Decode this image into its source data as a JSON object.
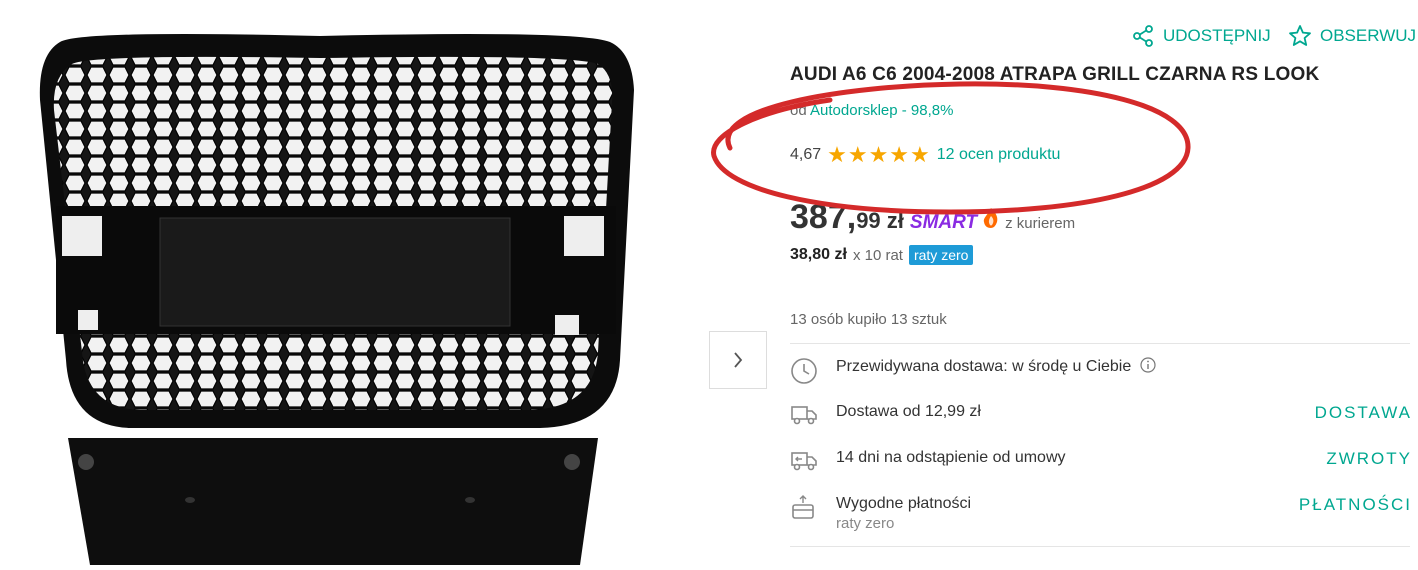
{
  "header": {
    "share_label": "UDOSTĘPNIJ",
    "observe_label": "OBSERWUJ"
  },
  "product": {
    "title": "AUDI A6 C6 2004-2008 ATRAPA GRILL CZARNA RS LOOK",
    "seller_prefix": "od",
    "seller_name": "Autodorsklep - 98,8%",
    "rating_value": "4,67",
    "rating_stars": 5,
    "rating_count": "12 ocen produktu",
    "price_main": "387,",
    "price_decimal": "99 zł",
    "smart_label": "SMART",
    "smart_sub": "z kurierem",
    "installment_amount": "38,80 zł",
    "installment_text": "x 10 rat",
    "installment_badge": "raty zero",
    "sold_info": "13 osób kupiło 13 sztuk"
  },
  "info_rows": [
    {
      "icon": "clock-icon",
      "text": "Przewidywana dostawa: w środę u Ciebie",
      "link": ""
    },
    {
      "icon": "truck-icon",
      "text": "Dostawa od 12,99 zł",
      "link": "DOSTAWA"
    },
    {
      "icon": "return-truck-icon",
      "text": "14 dni na odstąpienie od umowy",
      "link": "ZWROTY"
    },
    {
      "icon": "payment-icon",
      "text": "Wygodne płatności",
      "sub": "raty zero",
      "link": "PŁATNOŚCI"
    }
  ],
  "colors": {
    "accent": "#00a790",
    "star": "#f7a600",
    "smart": "#8a2be2",
    "badge": "#1e9bd7",
    "annotation": "#d42a2a"
  }
}
